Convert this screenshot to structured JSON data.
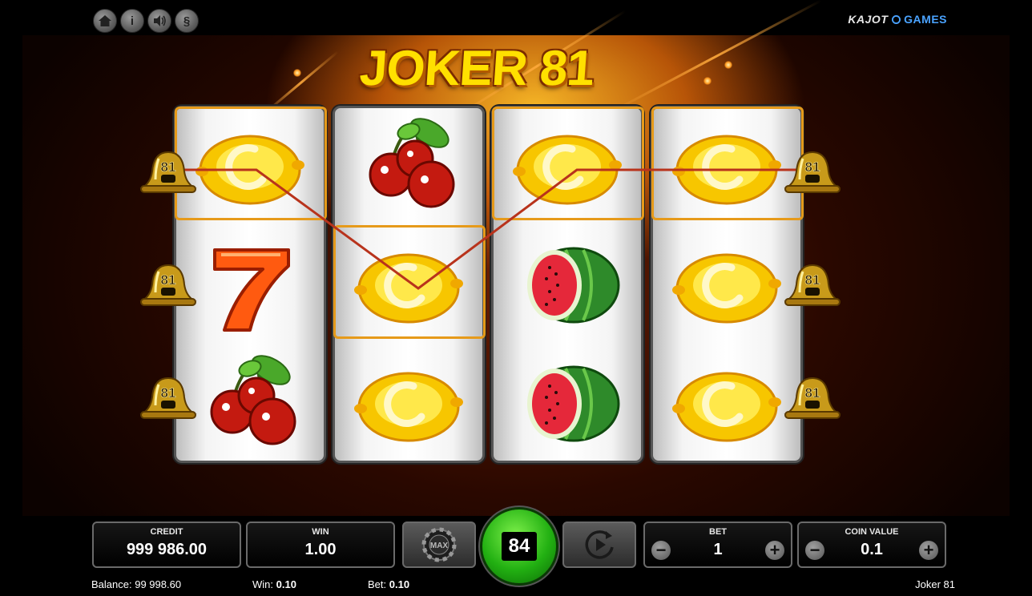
{
  "top_bar": {
    "buttons": [
      {
        "name": "home-icon",
        "glyph": "⌂"
      },
      {
        "name": "info-icon",
        "glyph": "i"
      },
      {
        "name": "sound-icon",
        "glyph": "◀"
      },
      {
        "name": "paragraph-icon",
        "glyph": "§"
      }
    ],
    "logo_left": "KAJOT",
    "logo_right": "GAMES"
  },
  "game": {
    "title": "JOKER 81",
    "bell_label": "81",
    "reels": [
      [
        "lemon",
        "seven",
        "cherries"
      ],
      [
        "cherries",
        "lemon",
        "lemon"
      ],
      [
        "lemon",
        "watermelon",
        "watermelon"
      ],
      [
        "lemon",
        "lemon",
        "lemon"
      ]
    ],
    "winning_cells": [
      [
        0,
        0
      ],
      [
        1,
        1
      ],
      [
        2,
        0
      ],
      [
        3,
        0
      ]
    ],
    "win_line_color": "#b8331c",
    "highlight_color": "#e69a1a"
  },
  "controls": {
    "credit": {
      "label": "CREDIT",
      "value": "999 986.00"
    },
    "win": {
      "label": "WIN",
      "value": "1.00"
    },
    "max_label": "MAX",
    "spin_value": "84",
    "bet": {
      "label": "BET",
      "value": "1"
    },
    "coin_value": {
      "label": "COIN VALUE",
      "value": "0.1"
    },
    "minus": "−",
    "plus": "+"
  },
  "status_bar": {
    "balance_label": "Balance:",
    "balance_value": "99 998.60",
    "win_label": "Win:",
    "win_value": "0.10",
    "bet_label": "Bet:",
    "bet_value": "0.10",
    "game_name": "Joker 81"
  }
}
